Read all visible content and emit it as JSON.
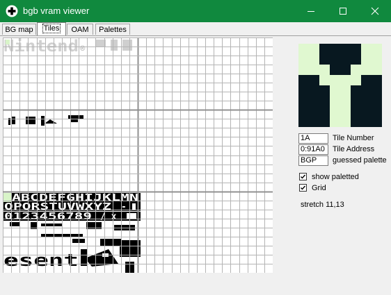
{
  "window": {
    "title": "bgb vram viewer",
    "icon": "game-controller-icon",
    "title_bar_color": "#10893e",
    "controls": [
      "minimize-icon",
      "maximize-icon",
      "close-icon"
    ]
  },
  "tabs": [
    {
      "label": "BG map",
      "selected": false
    },
    {
      "label": "Tiles",
      "selected": true
    },
    {
      "label": "OAM",
      "selected": false
    },
    {
      "label": "Palettes",
      "selected": false
    }
  ],
  "tile_canvas": {
    "grid": "on",
    "grid_color": "#b4b4b4",
    "bank_separator_color": "#909090",
    "selected_tile_color": "#d8f4c8",
    "ink_color": "#000000",
    "visible_text_fragments": [
      "ABCDEFGHIJKLMN",
      "OPQRSTUVWXYZ",
      "0123456789",
      "®",
      "esent"
    ]
  },
  "preview": {
    "palette": [
      "#e0f8d0",
      "#88c070",
      "#346856",
      "#081820"
    ]
  },
  "fields": {
    "tile_number": {
      "value": "1A",
      "label": "Tile Number"
    },
    "tile_address": {
      "value": "0:91A0",
      "label": "Tile Address"
    },
    "palette": {
      "value": "BGP",
      "label": "guessed palette"
    }
  },
  "options": [
    {
      "label": "show paletted",
      "checked": true
    },
    {
      "label": "Grid",
      "checked": true
    }
  ],
  "stretch": "stretch 11,13"
}
